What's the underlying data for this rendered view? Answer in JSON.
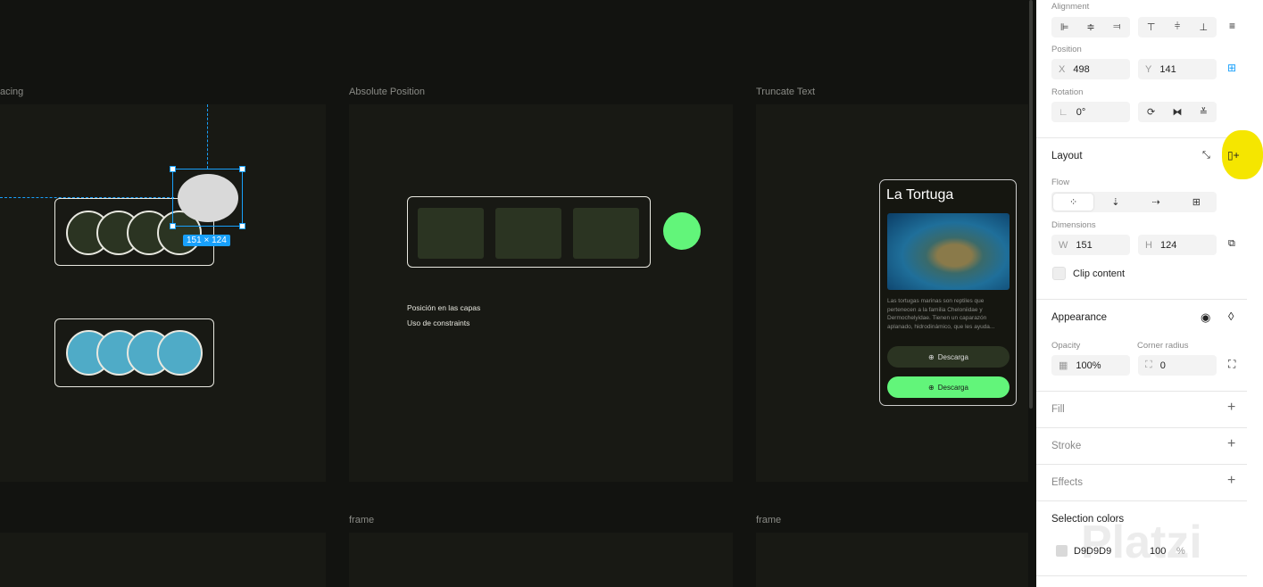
{
  "canvas": {
    "frames": [
      {
        "label": "acing"
      },
      {
        "label": "Absolute Position"
      },
      {
        "label": "Truncate Text"
      },
      {
        "label": "frame"
      },
      {
        "label": "frame"
      }
    ],
    "selection_size": "151 × 124",
    "position_notes": [
      "Posición en las capas",
      "Uso de constraints"
    ],
    "card": {
      "title": "La Tortuga",
      "body": "Las tortugas marinas son reptiles que pertenecen a la familia Cheloniidae y Dermochelyidae. Tienen un caparazón aplanado, hidrodinámico, que les ayuda...",
      "button_dark": "Descarga",
      "button_green": "Descarga"
    }
  },
  "panel": {
    "alignment_label": "Alignment",
    "position_label": "Position",
    "x_key": "X",
    "x": "498",
    "y_key": "Y",
    "y": "141",
    "rotation_label": "Rotation",
    "rotation": "0°",
    "layout_title": "Layout",
    "flow_label": "Flow",
    "dimensions_label": "Dimensions",
    "w_key": "W",
    "w": "151",
    "h_key": "H",
    "h": "124",
    "clip_content": "Clip content",
    "appearance_title": "Appearance",
    "opacity_label": "Opacity",
    "opacity": "100%",
    "corner_label": "Corner radius",
    "corner": "0",
    "fill": "Fill",
    "stroke": "Stroke",
    "effects": "Effects",
    "selection_colors": "Selection colors",
    "color_hex": "D9D9D9",
    "color_opacity": "100",
    "percent": "%",
    "watermark": "Platzi"
  },
  "colors": {
    "accent": "#18a0fb",
    "green": "#62f57a",
    "teal": "#4fabc7",
    "highlight": "#f5e600"
  }
}
